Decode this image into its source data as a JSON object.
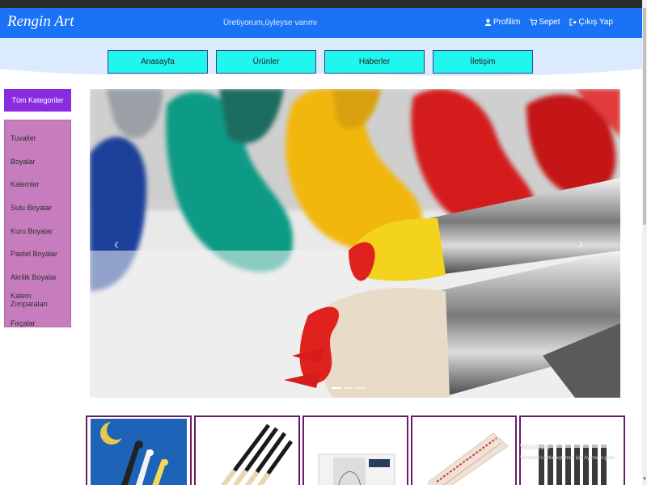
{
  "brand": "Rengin Art",
  "slogan": "Üretiyorum,üyleyse varımı",
  "user_links": [
    {
      "label": "Profilim",
      "icon": "user-icon"
    },
    {
      "label": "Sepet",
      "icon": "cart-icon"
    },
    {
      "label": "Çıkış Yap",
      "icon": "logout-icon"
    }
  ],
  "menu": [
    "Anasayfa",
    "Ürünler",
    "Haberler",
    "İletişim"
  ],
  "categories": {
    "header": "Tüm Kategoriler",
    "items": [
      "Tuvaller",
      "Boyalar",
      "Kalemler",
      "Sulu Boyalar",
      "Kuru Boyalar",
      "Pastel Boyalar",
      "Akrilik Boyalar",
      "Kalem Zımparaları",
      "Fırçalar"
    ]
  },
  "carousel": {
    "prev_icon": "chevron-left-icon",
    "next_icon": "chevron-right-icon",
    "slide_count": 3,
    "active_slide": 1
  },
  "products": [
    {
      "image": "painted-brushes-image"
    },
    {
      "image": "brush-set-image"
    },
    {
      "image": "sketch-book-image"
    },
    {
      "image": "brush-roll-case-image"
    },
    {
      "image": "pencil-set-image"
    }
  ],
  "watermark": {
    "line1": "Windows",
    "line2": "Windows'u etkinleştirmek için Ayarlar'a gidin."
  },
  "colors": {
    "navbar": "#1a73f5",
    "menu_button": "#1ff6ee",
    "category_header": "#8a2be2",
    "category_list": "#c77dbd",
    "card_border": "#6a1a6a"
  }
}
